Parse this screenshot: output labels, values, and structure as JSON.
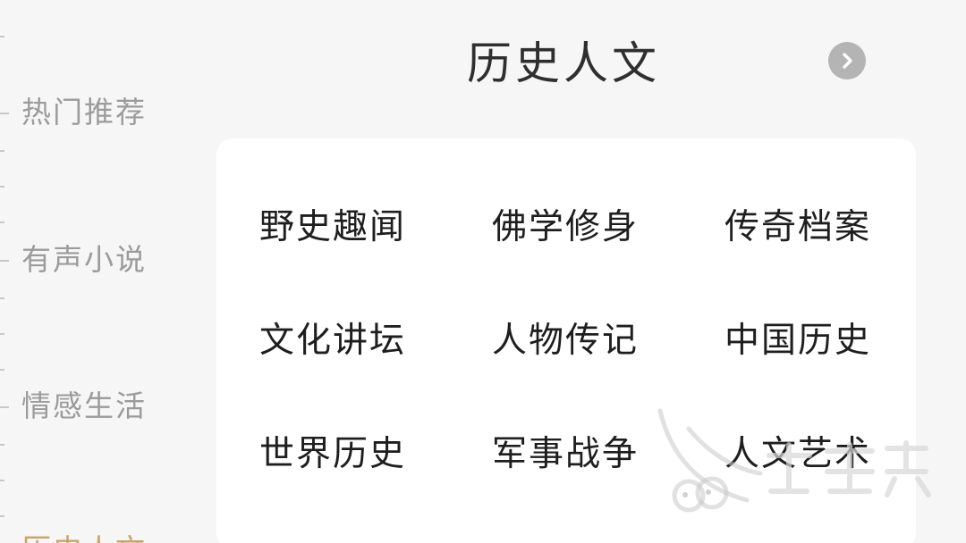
{
  "sidebar": {
    "items": [
      {
        "label": "热门推荐"
      },
      {
        "label": "有声小说"
      },
      {
        "label": "情感生活"
      },
      {
        "label": "历史人文"
      }
    ]
  },
  "header": {
    "title": "历史人文",
    "next_icon": "chevron-right-circle-icon"
  },
  "categories": {
    "row1": [
      "野史趣闻",
      "佛学修身",
      "传奇档案"
    ],
    "row2": [
      "文化讲坛",
      "人物传记",
      "中国历史"
    ],
    "row3": [
      "世界历史",
      "军事战争",
      "人文艺术"
    ]
  },
  "colors": {
    "background": "#f6f6f6",
    "sidebar_text": "#9b9b9b",
    "active_text": "#c9a46a",
    "card": "#ffffff",
    "next_button": "#b4b4b4"
  }
}
